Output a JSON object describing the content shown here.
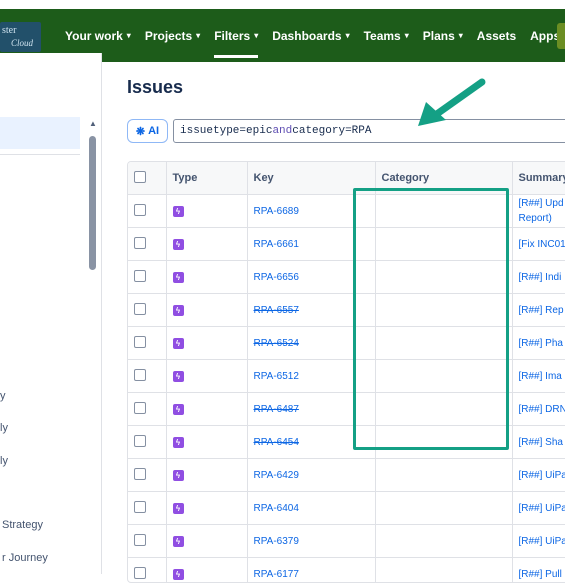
{
  "topnav": {
    "logo_line1": "ster",
    "logo_line2": "Cloud",
    "items": [
      {
        "label": "Your work",
        "dropdown": true
      },
      {
        "label": "Projects",
        "dropdown": true
      },
      {
        "label": "Filters",
        "dropdown": true,
        "active": true
      },
      {
        "label": "Dashboards",
        "dropdown": true
      },
      {
        "label": "Teams",
        "dropdown": true
      },
      {
        "label": "Plans",
        "dropdown": true
      },
      {
        "label": "Assets",
        "dropdown": false
      },
      {
        "label": "Apps",
        "dropdown": true
      }
    ]
  },
  "sidebar": {
    "fragments": [
      "y",
      "ly",
      "ly",
      "Strategy",
      "r Journey"
    ]
  },
  "page": {
    "title": "Issues",
    "ai_label": "AI",
    "jql": {
      "field1": "issuetype",
      "eq": "=",
      "value1": "epic",
      "op": "and",
      "field2": "category",
      "value2": "RPA"
    }
  },
  "table": {
    "columns": [
      "Type",
      "Key",
      "Category",
      "Summary"
    ],
    "rows": [
      {
        "key": "RPA-6689",
        "done": false,
        "category": "",
        "summary": "[R##] Upd",
        "summary2": "Report)"
      },
      {
        "key": "RPA-6661",
        "done": false,
        "category": "",
        "summary": "[Fix INC01"
      },
      {
        "key": "RPA-6656",
        "done": false,
        "category": "",
        "summary": "[R##] Indi"
      },
      {
        "key": "RPA-6557",
        "done": true,
        "category": "",
        "summary": "[R##] Rep"
      },
      {
        "key": "RPA-6524",
        "done": true,
        "category": "",
        "summary": "[R##] Pha"
      },
      {
        "key": "RPA-6512",
        "done": false,
        "category": "",
        "summary": "[R##] Ima"
      },
      {
        "key": "RPA-6487",
        "done": true,
        "category": "",
        "summary": "[R##] DRN"
      },
      {
        "key": "RPA-6454",
        "done": true,
        "category": "",
        "summary": "[R##] Sha"
      },
      {
        "key": "RPA-6429",
        "done": false,
        "category": "",
        "summary": "[R##] UiPa"
      },
      {
        "key": "RPA-6404",
        "done": false,
        "category": "",
        "summary": "[R##] UiPa"
      },
      {
        "key": "RPA-6379",
        "done": false,
        "category": "",
        "summary": "[R##] UiPa"
      },
      {
        "key": "RPA-6177",
        "done": false,
        "category": "",
        "summary": "[R##] Pull"
      }
    ]
  },
  "colors": {
    "nav_bg": "#1d5c1a",
    "link": "#0c66e4",
    "epic": "#904ee2",
    "annotation": "#14a085"
  },
  "icons": [
    "chevron-down-icon",
    "sparkle-ai-icon",
    "epic-lightning-icon",
    "checkbox-icon",
    "scroll-up-icon"
  ]
}
